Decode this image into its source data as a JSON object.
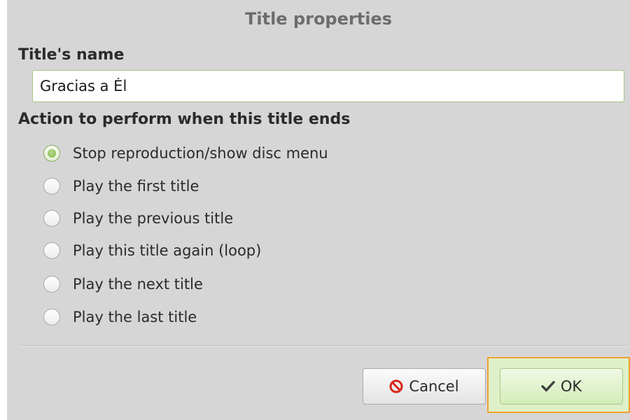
{
  "dialog": {
    "title": "Title properties"
  },
  "name_section": {
    "label": "Title's name",
    "value": "Gracias a Él"
  },
  "action_section": {
    "label": "Action to perform when this title ends",
    "options": [
      {
        "label": "Stop reproduction/show disc menu",
        "checked": true
      },
      {
        "label": "Play the first title",
        "checked": false
      },
      {
        "label": "Play the previous title",
        "checked": false
      },
      {
        "label": "Play this title again (loop)",
        "checked": false
      },
      {
        "label": "Play the next title",
        "checked": false
      },
      {
        "label": "Play the last title",
        "checked": false
      }
    ]
  },
  "buttons": {
    "cancel_label": "Cancel",
    "cancel_icon": "cancel-icon",
    "ok_label": "OK",
    "ok_icon": "checkmark-icon"
  },
  "colors": {
    "accent_green": "#7cb342",
    "focus_orange": "#f0a030",
    "cancel_red": "#d7261e"
  }
}
